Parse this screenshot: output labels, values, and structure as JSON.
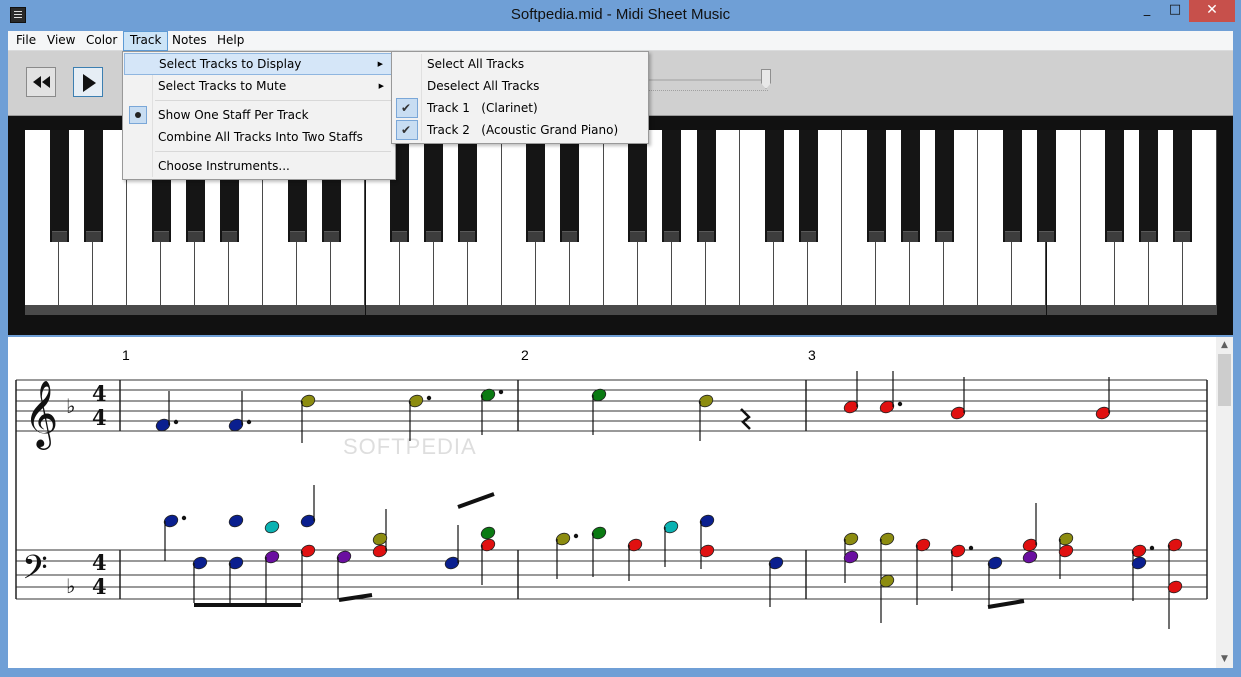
{
  "window": {
    "title": "Softpedia.mid - Midi Sheet Music",
    "min_glyph": "_",
    "max_glyph": "□",
    "close_glyph": "✕"
  },
  "menubar": [
    "File",
    "View",
    "Color",
    "Track",
    "Notes",
    "Help"
  ],
  "track_menu": {
    "items": [
      "Select Tracks to Display",
      "Select Tracks to Mute",
      "Show One Staff Per Track",
      "Combine All Tracks Into Two Staffs",
      "Choose Instruments..."
    ],
    "submenu_arrow": "▶"
  },
  "display_submenu": {
    "items": [
      "Select All Tracks",
      "Deselect All Tracks",
      "Track 1   (Clarinet)",
      "Track 2   (Acoustic Grand Piano)"
    ],
    "check_glyph": "✔"
  },
  "sheet": {
    "measure_numbers": [
      "1",
      "2",
      "3"
    ],
    "watermark": "SOFTPEDIA"
  },
  "scrollbar": {
    "up_glyph": "▲",
    "down_glyph": "▼"
  },
  "colors": {
    "titlebar": "#6f9fd6",
    "note_navy": "#0a1f8f",
    "note_olive": "#8c8c10",
    "note_green": "#0a7a12",
    "note_red": "#e01010",
    "note_purple": "#6a0fa0",
    "note_cyan": "#0ab2b2"
  }
}
